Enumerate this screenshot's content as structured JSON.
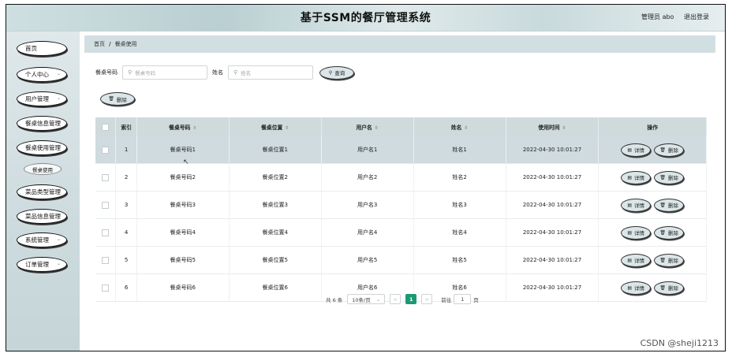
{
  "header": {
    "title": "基于SSM的餐厅管理系统",
    "user_label": "管理员 abo",
    "logout_label": "退出登录"
  },
  "sidebar": {
    "items": [
      {
        "label": "首页",
        "has_arrow": false
      },
      {
        "label": "个人中心",
        "has_arrow": true
      },
      {
        "label": "用户管理",
        "has_arrow": true
      },
      {
        "label": "餐桌信息管理",
        "has_arrow": true
      },
      {
        "label": "餐桌使用管理",
        "has_arrow": true
      },
      {
        "label": "菜品类型管理",
        "has_arrow": true
      },
      {
        "label": "菜品信息管理",
        "has_arrow": true
      },
      {
        "label": "系统管理",
        "has_arrow": true
      },
      {
        "label": "订单管理",
        "has_arrow": true
      }
    ],
    "submenu": {
      "label": "餐桌使用"
    }
  },
  "breadcrumb": {
    "home": "首页",
    "sep": "/",
    "current": "餐桌使用"
  },
  "search": {
    "table_no_label": "餐桌号码",
    "table_no_placeholder": "餐桌号码",
    "name_label": "姓名",
    "name_placeholder": "姓名",
    "query_label": "查询",
    "delete_label": "删除"
  },
  "table": {
    "headers": {
      "index": "索引",
      "table_no": "餐桌号码",
      "position": "餐桌位置",
      "username": "用户名",
      "name": "姓名",
      "time": "使用时间",
      "actions": "操作"
    },
    "rows": [
      {
        "index": "1",
        "table_no": "餐桌号码1",
        "position": "餐桌位置1",
        "username": "用户名1",
        "name": "姓名1",
        "time": "2022-04-30 10:01:27"
      },
      {
        "index": "2",
        "table_no": "餐桌号码2",
        "position": "餐桌位置2",
        "username": "用户名2",
        "name": "姓名2",
        "time": "2022-04-30 10:01:27"
      },
      {
        "index": "3",
        "table_no": "餐桌号码3",
        "position": "餐桌位置3",
        "username": "用户名3",
        "name": "姓名3",
        "time": "2022-04-30 10:01:27"
      },
      {
        "index": "4",
        "table_no": "餐桌号码4",
        "position": "餐桌位置4",
        "username": "用户名4",
        "name": "姓名4",
        "time": "2022-04-30 10:01:27"
      },
      {
        "index": "5",
        "table_no": "餐桌号码5",
        "position": "餐桌位置5",
        "username": "用户名5",
        "name": "姓名5",
        "time": "2022-04-30 10:01:27"
      },
      {
        "index": "6",
        "table_no": "餐桌号码6",
        "position": "餐桌位置6",
        "username": "用户名6",
        "name": "姓名6",
        "time": "2022-04-30 10:01:27"
      }
    ],
    "detail_label": "详情",
    "delete_label": "删除"
  },
  "pagination": {
    "total": "共 6 条",
    "page_size": "10条/页",
    "prev": "<",
    "current_page": "1",
    "next": ">",
    "goto_label": "前往",
    "goto_value": "1",
    "page_suffix": "页"
  },
  "watermark": "CSDN @sheji1213",
  "colors": {
    "accent": "#1a9a73",
    "header_bg": "#cfdadd",
    "sidebar_bg": "#cddbde"
  }
}
